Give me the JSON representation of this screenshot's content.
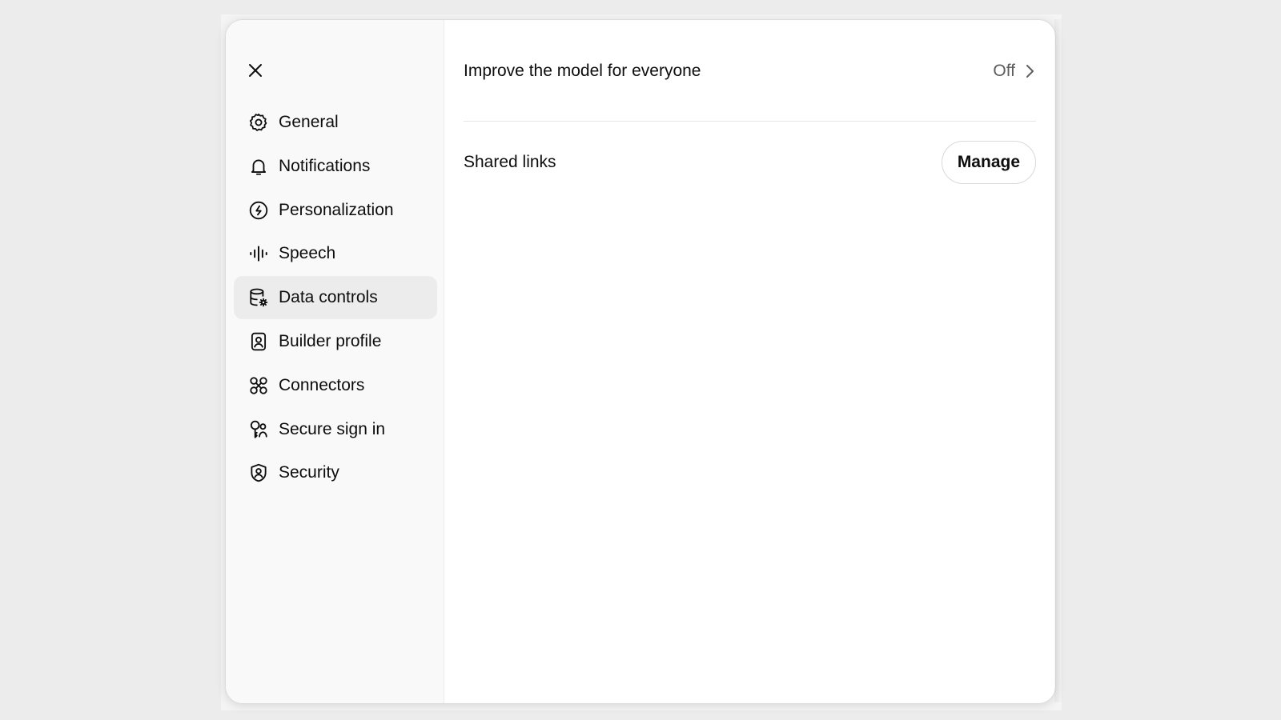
{
  "colors": {
    "sidebar_bg": "#f9f9f9",
    "active_item_bg": "#ececec",
    "text_primary": "#0d0d0d",
    "text_secondary": "#5d5d5d"
  },
  "close_button": {
    "icon": "close-icon"
  },
  "sidebar": {
    "items": [
      {
        "label": "General",
        "icon": "gear-icon",
        "active": false
      },
      {
        "label": "Notifications",
        "icon": "bell-icon",
        "active": false
      },
      {
        "label": "Personalization",
        "icon": "personalization-icon",
        "active": false
      },
      {
        "label": "Speech",
        "icon": "waveform-icon",
        "active": false
      },
      {
        "label": "Data controls",
        "icon": "database-gear-icon",
        "active": true
      },
      {
        "label": "Builder profile",
        "icon": "id-badge-icon",
        "active": false
      },
      {
        "label": "Connectors",
        "icon": "connectors-icon",
        "active": false
      },
      {
        "label": "Secure sign in",
        "icon": "key-user-icon",
        "active": false
      },
      {
        "label": "Security",
        "icon": "shield-user-icon",
        "active": false
      }
    ]
  },
  "main": {
    "improve_model": {
      "label": "Improve the model for everyone",
      "value": "Off",
      "icon": "chevron-right-icon"
    },
    "shared_links": {
      "label": "Shared links",
      "button_label": "Manage"
    }
  }
}
